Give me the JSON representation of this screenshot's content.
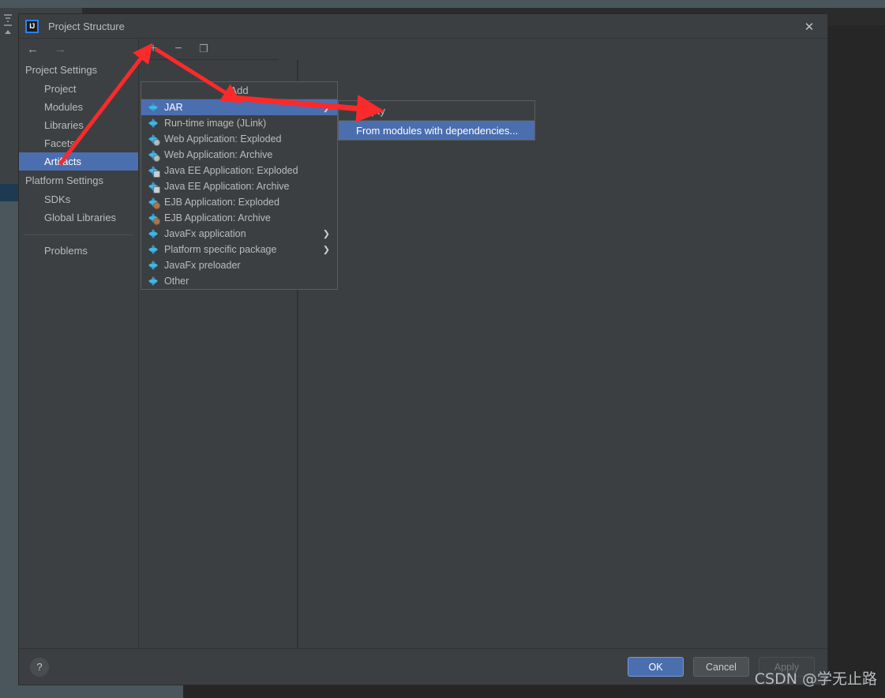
{
  "window": {
    "title": "Project Structure",
    "logo_text": "IJ",
    "close_icon": "✕"
  },
  "nav": {
    "back_icon": "←",
    "forward_icon": "→",
    "groups": [
      {
        "label": "Project Settings",
        "items": [
          {
            "label": "Project",
            "selected": false
          },
          {
            "label": "Modules",
            "selected": false
          },
          {
            "label": "Libraries",
            "selected": false
          },
          {
            "label": "Facets",
            "selected": false
          },
          {
            "label": "Artifacts",
            "selected": true
          }
        ]
      },
      {
        "label": "Platform Settings",
        "items": [
          {
            "label": "SDKs",
            "selected": false
          },
          {
            "label": "Global Libraries",
            "selected": false
          }
        ]
      }
    ],
    "problems_label": "Problems"
  },
  "toolbar": {
    "add_icon": "+",
    "remove_icon": "−",
    "copy_icon": "❐"
  },
  "add_menu": {
    "header": "Add",
    "items": [
      {
        "label": "JAR",
        "icon": "artifact-jar-icon",
        "badge": "",
        "submenu": true,
        "selected": true
      },
      {
        "label": "Run-time image (JLink)",
        "icon": "artifact-jlink-icon",
        "badge": "",
        "submenu": false,
        "selected": false
      },
      {
        "label": "Web Application: Exploded",
        "icon": "artifact-web-exploded-icon",
        "badge": "web",
        "submenu": false,
        "selected": false
      },
      {
        "label": "Web Application: Archive",
        "icon": "artifact-web-archive-icon",
        "badge": "web",
        "submenu": false,
        "selected": false
      },
      {
        "label": "Java EE Application: Exploded",
        "icon": "artifact-javaee-exploded-icon",
        "badge": "ee",
        "submenu": false,
        "selected": false
      },
      {
        "label": "Java EE Application: Archive",
        "icon": "artifact-javaee-archive-icon",
        "badge": "ee",
        "submenu": false,
        "selected": false
      },
      {
        "label": "EJB Application: Exploded",
        "icon": "artifact-ejb-exploded-icon",
        "badge": "ejb",
        "submenu": false,
        "selected": false
      },
      {
        "label": "EJB Application: Archive",
        "icon": "artifact-ejb-archive-icon",
        "badge": "ejb",
        "submenu": false,
        "selected": false
      },
      {
        "label": "JavaFx application",
        "icon": "artifact-javafx-app-icon",
        "badge": "",
        "submenu": true,
        "selected": false
      },
      {
        "label": "Platform specific package",
        "icon": "artifact-platform-package-icon",
        "badge": "",
        "submenu": true,
        "selected": false
      },
      {
        "label": "JavaFx preloader",
        "icon": "artifact-javafx-preloader-icon",
        "badge": "",
        "submenu": false,
        "selected": false
      },
      {
        "label": "Other",
        "icon": "artifact-other-icon",
        "badge": "",
        "submenu": false,
        "selected": false
      }
    ],
    "submenu_arrow": "❯"
  },
  "sub_menu": {
    "items": [
      {
        "label": "Empty",
        "selected": false
      },
      {
        "label": "From modules with dependencies...",
        "selected": true
      }
    ]
  },
  "footer": {
    "help_icon": "?",
    "ok_label": "OK",
    "cancel_label": "Cancel",
    "apply_label": "Apply"
  },
  "watermark": "CSDN @学无止路",
  "colors": {
    "accent": "#4b6eaf",
    "dialog_bg": "#3c3f41",
    "sidebar_bg": "#3c4043",
    "annotation": "#fb2a2a",
    "icon_cyan": "#40b6e0"
  }
}
